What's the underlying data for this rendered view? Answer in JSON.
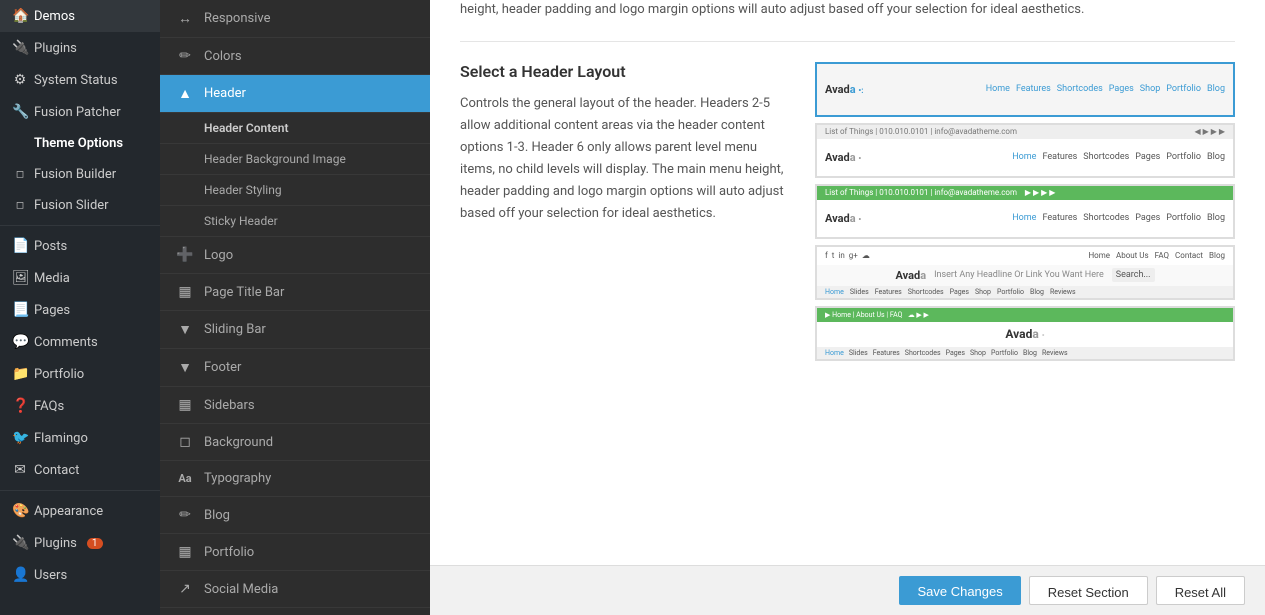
{
  "adminSidebar": {
    "items": [
      {
        "label": "Demos",
        "icon": "🏠",
        "active": false
      },
      {
        "label": "Plugins",
        "icon": "🔌",
        "active": false
      },
      {
        "label": "System Status",
        "icon": "⚙",
        "active": false
      },
      {
        "label": "Fusion Patcher",
        "icon": "🔧",
        "active": false
      },
      {
        "label": "Theme Options",
        "icon": "",
        "active": true,
        "bold": true
      },
      {
        "label": "Fusion Builder",
        "icon": "◻",
        "active": false
      },
      {
        "label": "Fusion Slider",
        "icon": "◻",
        "active": false
      },
      {
        "label": "Posts",
        "icon": "📄",
        "active": false
      },
      {
        "label": "Media",
        "icon": "🖼",
        "active": false
      },
      {
        "label": "Pages",
        "icon": "📃",
        "active": false
      },
      {
        "label": "Comments",
        "icon": "💬",
        "active": false
      },
      {
        "label": "Portfolio",
        "icon": "📁",
        "active": false
      },
      {
        "label": "FAQs",
        "icon": "❓",
        "active": false
      },
      {
        "label": "Flamingo",
        "icon": "🐦",
        "active": false
      },
      {
        "label": "Contact",
        "icon": "✉",
        "active": false
      },
      {
        "label": "Appearance",
        "icon": "🎨",
        "active": false
      },
      {
        "label": "Plugins",
        "icon": "🔌",
        "badge": "1",
        "active": false
      },
      {
        "label": "Users",
        "icon": "👤",
        "active": false
      }
    ]
  },
  "themeSidebar": {
    "items": [
      {
        "label": "Responsive",
        "icon": "↔",
        "active": false,
        "type": "main"
      },
      {
        "label": "Colors",
        "icon": "✏",
        "active": false,
        "type": "main"
      },
      {
        "label": "Header",
        "icon": "▲",
        "active": true,
        "type": "main"
      },
      {
        "label": "Header Content",
        "type": "section-header"
      },
      {
        "label": "Header Background Image",
        "type": "sub"
      },
      {
        "label": "Header Styling",
        "type": "sub"
      },
      {
        "label": "Sticky Header",
        "type": "sub"
      },
      {
        "label": "Logo",
        "icon": "➕",
        "active": false,
        "type": "main"
      },
      {
        "label": "Page Title Bar",
        "icon": "▦",
        "active": false,
        "type": "main"
      },
      {
        "label": "Sliding Bar",
        "icon": "▼",
        "active": false,
        "type": "main"
      },
      {
        "label": "Footer",
        "icon": "▼",
        "active": false,
        "type": "main"
      },
      {
        "label": "Sidebars",
        "icon": "▦",
        "active": false,
        "type": "main"
      },
      {
        "label": "Background",
        "icon": "◻",
        "active": false,
        "type": "main"
      },
      {
        "label": "Typography",
        "icon": "Aa",
        "active": false,
        "type": "main"
      },
      {
        "label": "Blog",
        "icon": "✏",
        "active": false,
        "type": "main"
      },
      {
        "label": "Portfolio",
        "icon": "▦",
        "active": false,
        "type": "main"
      },
      {
        "label": "Social Media",
        "icon": "↗",
        "active": false,
        "type": "main"
      }
    ]
  },
  "mainContent": {
    "topText": "height, header padding and logo margin options will auto adjust based off your selection for ideal aesthetics.",
    "sectionTitle": "Select a Header Layout",
    "sectionDescription": "Controls the general layout of the header. Headers 2-5 allow additional content areas via the header content options 1-3. Header 6 only allows parent level menu items, no child levels will display. The main menu height, header padding and logo margin options will auto adjust based off your selection for ideal aesthetics."
  },
  "footer": {
    "saveLabel": "Save Changes",
    "resetSectionLabel": "Reset Section",
    "resetAllLabel": "Reset All"
  },
  "layouts": [
    {
      "id": 1,
      "selected": true
    },
    {
      "id": 2,
      "selected": false
    },
    {
      "id": 3,
      "selected": false
    },
    {
      "id": 4,
      "selected": false
    },
    {
      "id": 5,
      "selected": false
    }
  ]
}
